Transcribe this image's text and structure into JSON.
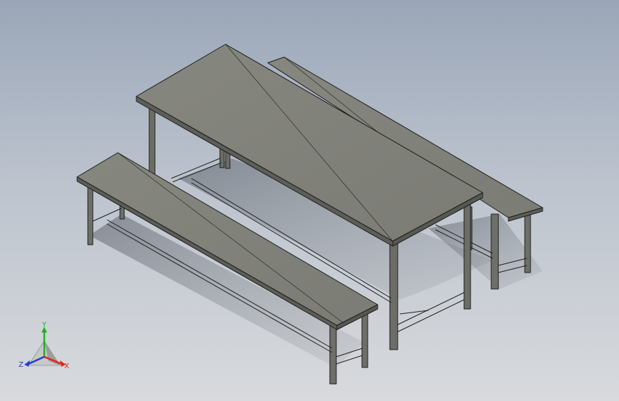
{
  "viewport": {
    "background_top": "#9aa6b8",
    "background_bottom": "#d8dadd"
  },
  "model": {
    "parts": [
      "table",
      "bench-front",
      "bench-back"
    ],
    "surface_color": "#80817b",
    "edge_color": "#1e1f1c"
  },
  "triad": {
    "x_label": "X",
    "y_label": "Y",
    "z_label": "Z",
    "x_color": "#e2231a",
    "y_color": "#22b022",
    "z_color": "#1f3fd6"
  }
}
